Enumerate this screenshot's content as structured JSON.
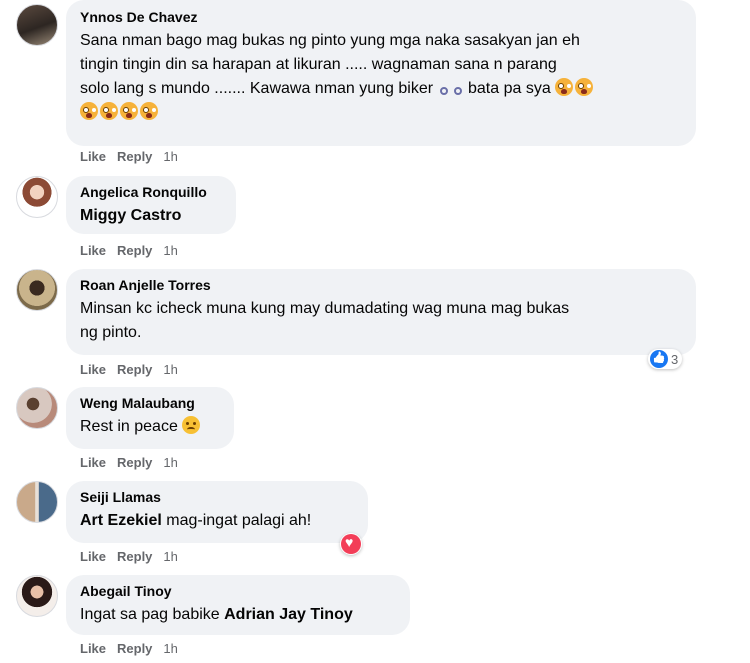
{
  "comments": [
    {
      "author": "Ynnos De Chavez",
      "lines": [
        "Sana nman bago mag bukas ng pinto yung mga naka sasakyan jan eh",
        "tingin tingin din sa harapan at likuran ..... wagnaman sana n parang",
        "solo lang s mundo ....... Kawawa nman yung biker",
        "bata pa sya"
      ],
      "like": "Like",
      "reply": "Reply",
      "time": "1h"
    },
    {
      "author": "Angelica Ronquillo",
      "mention": "Miggy Castro",
      "like": "Like",
      "reply": "Reply",
      "time": "1h"
    },
    {
      "author": "Roan Anjelle Torres",
      "lines": [
        "Minsan kc icheck muna kung may dumadating wag muna mag bukas",
        "ng pinto."
      ],
      "reaction_count": "3",
      "like": "Like",
      "reply": "Reply",
      "time": "1h"
    },
    {
      "author": "Weng Malaubang",
      "text": "Rest in peace",
      "like": "Like",
      "reply": "Reply",
      "time": "1h"
    },
    {
      "author": "Seiji Llamas",
      "mention": "Art Ezekiel",
      "text": " mag-ingat palagi ah!",
      "like": "Like",
      "reply": "Reply",
      "time": "1h"
    },
    {
      "author": "Abegail Tinoy",
      "text": "Ingat sa pag babike ",
      "mention": "Adrian Jay Tinoy",
      "like": "Like",
      "reply": "Reply",
      "time": "1h"
    }
  ],
  "colors": {
    "bubble": "#f0f2f5",
    "meta": "#65676b",
    "like_blue": "#1877f2",
    "heart_red": "#f33e58"
  },
  "icons": [
    "bicycle-emoji",
    "crying-face-emoji",
    "sad-face-emoji",
    "like-reaction-icon",
    "heart-reaction-icon"
  ]
}
